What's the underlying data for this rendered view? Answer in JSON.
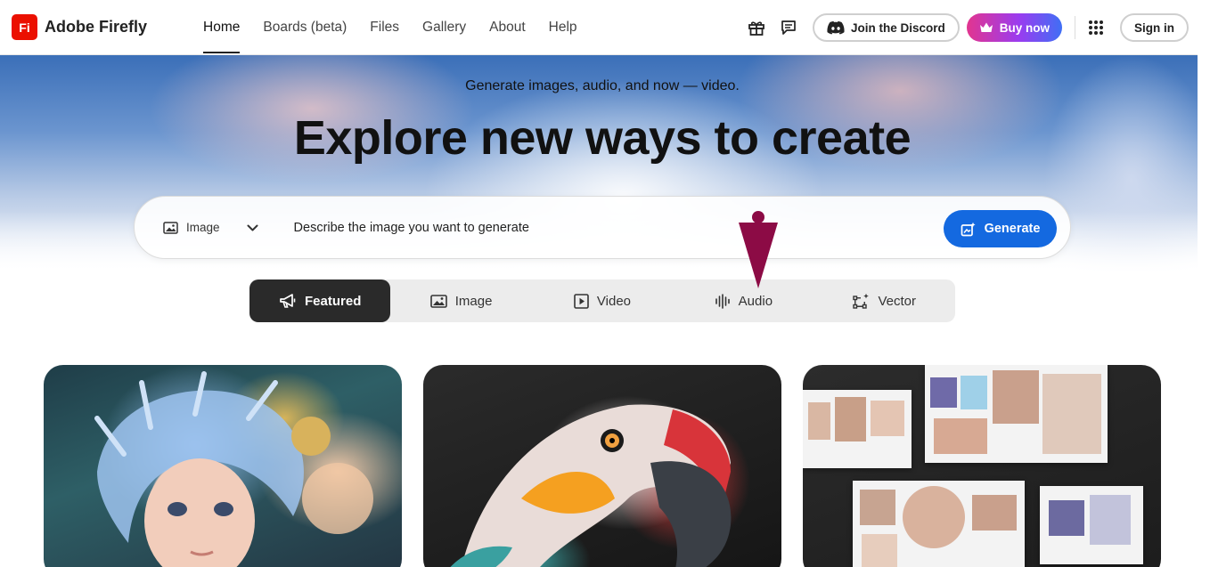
{
  "brand": {
    "logo_text": "Fi",
    "name": "Adobe Firefly",
    "logo_color": "#eb1000"
  },
  "nav": {
    "items": [
      {
        "label": "Home",
        "active": true
      },
      {
        "label": "Boards (beta)"
      },
      {
        "label": "Files"
      },
      {
        "label": "Gallery"
      },
      {
        "label": "About"
      },
      {
        "label": "Help"
      }
    ]
  },
  "header": {
    "icons": [
      "gift-icon",
      "chat-bubble-icon",
      "apps-grid-icon"
    ],
    "discord_label": "Join the Discord",
    "buy_label": "Buy now",
    "signin_label": "Sign in"
  },
  "hero": {
    "subtitle": "Generate images, audio, and now — video.",
    "title": "Explore new ways to create"
  },
  "prompt": {
    "type_label": "Image",
    "placeholder": "Describe the image you want to generate",
    "generate_label": "Generate",
    "accent": "#1469e0"
  },
  "tabs": [
    {
      "label": "Featured",
      "icon": "megaphone-icon",
      "active": true
    },
    {
      "label": "Image",
      "icon": "image-icon"
    },
    {
      "label": "Video",
      "icon": "video-icon"
    },
    {
      "label": "Audio",
      "icon": "audio-wave-icon"
    },
    {
      "label": "Vector",
      "icon": "vector-icon"
    }
  ],
  "gallery": {
    "cards": [
      "fantasy-portrait",
      "parrot",
      "product-moodboard"
    ]
  }
}
